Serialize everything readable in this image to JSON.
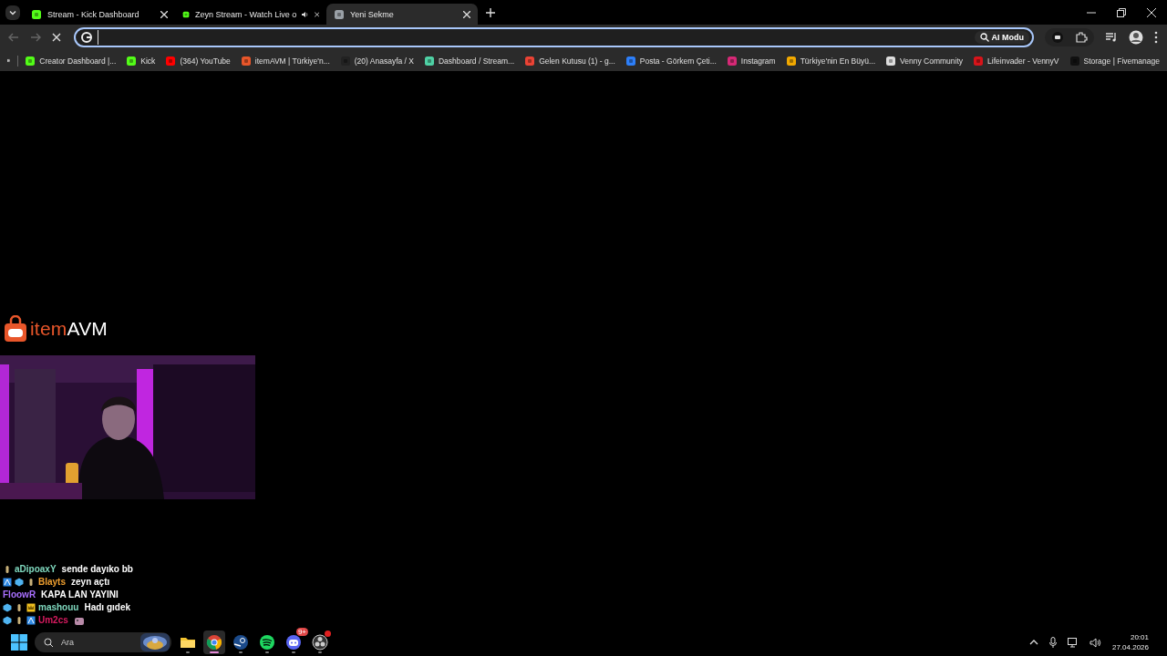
{
  "tabs": [
    {
      "title": "Stream - Kick Dashboard",
      "color": "#53fc18",
      "audio": false,
      "selected": false
    },
    {
      "title": "Zeyn Stream - Watch Live o",
      "color": "#53fc18",
      "audio": true,
      "selected": false
    },
    {
      "title": "Yeni Sekme",
      "color": "#9aa0a6",
      "audio": false,
      "selected": true
    }
  ],
  "omnibox": {
    "ai_button": "AI Modu"
  },
  "bookmarks": [
    {
      "label": "Creator Dashboard |...",
      "color": "#53fc18"
    },
    {
      "label": "Kick",
      "color": "#53fc18"
    },
    {
      "label": "(364) YouTube",
      "color": "#ff0000"
    },
    {
      "label": "itemAVM | Türkiye'n...",
      "color": "#e8562a"
    },
    {
      "label": "(20) Anasayfa / X",
      "color": "#222222"
    },
    {
      "label": "Dashboard / Stream...",
      "color": "#4fd1a5"
    },
    {
      "label": "Gelen Kutusu (1) - g...",
      "color": "#ea4335"
    },
    {
      "label": "Posta - Görkem Çeti...",
      "color": "#2d7ff9"
    },
    {
      "label": "Instagram",
      "color": "#d62976"
    },
    {
      "label": "Türkiye'nin En Büyü...",
      "color": "#f2a900"
    },
    {
      "label": "Venny Community",
      "color": "#dddddd"
    },
    {
      "label": "Lifeinvader - VennyV",
      "color": "#d7141a"
    },
    {
      "label": "Storage | Fivemanage",
      "color": "#111111"
    }
  ],
  "overlay": {
    "logo_part_1": "item",
    "logo_part_2": "AVM"
  },
  "chat": [
    {
      "user": "aDipoaxY",
      "color": "#7fd8be",
      "text": "sende dayıko bb",
      "badges": [
        {
          "kind": "mic"
        }
      ]
    },
    {
      "user": "Blayts",
      "color": "#f0a030",
      "text": "zeyn açtı",
      "badges": [
        {
          "kind": "sub"
        },
        {
          "kind": "gem"
        },
        {
          "kind": "mic"
        }
      ]
    },
    {
      "user": "FloowR",
      "color": "#a970ff",
      "text": "KAPA LAN YAYINI"
    },
    {
      "user": "mashouu",
      "color": "#7fd8be",
      "text": "Hadı gıdek",
      "badges": [
        {
          "kind": "gem"
        },
        {
          "kind": "mic"
        },
        {
          "kind": "crown"
        }
      ]
    },
    {
      "user": "Um2cs",
      "color": "#d81b60",
      "kind": "emote",
      "badges": [
        {
          "kind": "gem"
        },
        {
          "kind": "mic"
        },
        {
          "kind": "sub"
        }
      ]
    }
  ],
  "taskbar": {
    "search": {
      "placeholder": "Ara"
    },
    "apps": [
      {
        "kind": "files",
        "active": false
      },
      {
        "kind": "chrome",
        "active": true
      },
      {
        "kind": "steam",
        "active": false
      },
      {
        "kind": "spotify",
        "active": false
      },
      {
        "kind": "discord",
        "active": false,
        "badge": "9+"
      },
      {
        "kind": "obs",
        "active": false,
        "alert": true
      }
    ],
    "time": "20:01",
    "date": "27.04.2026"
  }
}
